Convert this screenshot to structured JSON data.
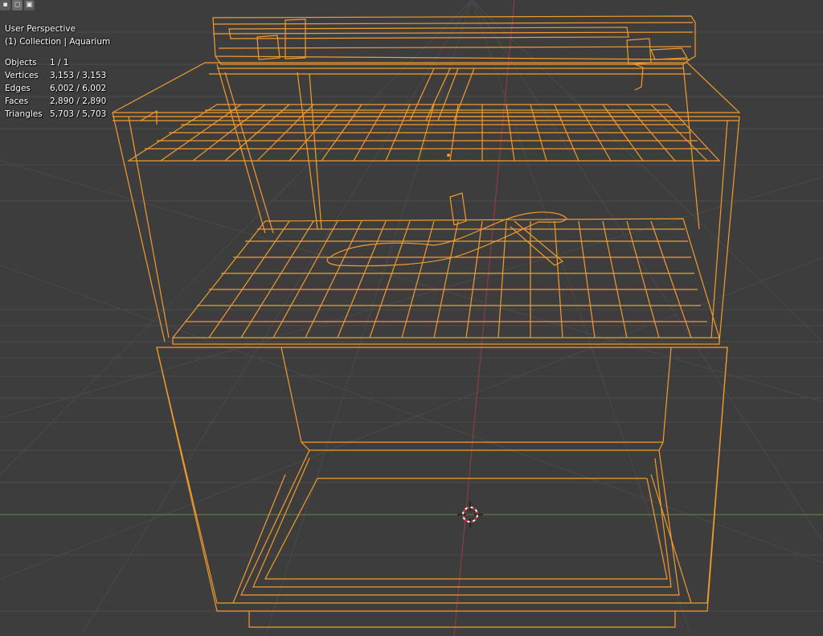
{
  "viewport": {
    "perspective_label": "User Perspective",
    "collection_label": "(1) Collection | Aquarium"
  },
  "stats": [
    {
      "label": "Objects",
      "value": "1 / 1"
    },
    {
      "label": "Vertices",
      "value": "3,153 / 3,153"
    },
    {
      "label": "Edges",
      "value": "6,002 / 6,002"
    },
    {
      "label": "Faces",
      "value": "2,890 / 2,890"
    },
    {
      "label": "Triangles",
      "value": "5,703 / 5,703"
    }
  ],
  "toolbar": {
    "icons": [
      "vertex-select-icon",
      "edge-select-icon",
      "face-select-icon"
    ]
  },
  "colors": {
    "background": "#3d3d3d",
    "grid": "#4a4a4a",
    "wire": "#f29b2e",
    "x_axis": "#9a3a48",
    "y_axis": "#6b8a2e"
  }
}
